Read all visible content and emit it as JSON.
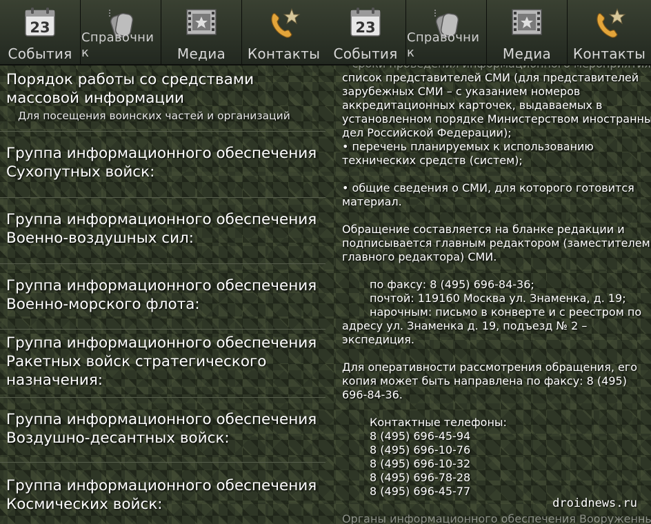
{
  "tabs": [
    {
      "label": "События",
      "icon": "calendar-icon",
      "day": "23"
    },
    {
      "label": "Справочник",
      "icon": "dog-tag-icon"
    },
    {
      "label": "Медиа",
      "icon": "film-icon"
    },
    {
      "label": "Контакты",
      "icon": "phone-star-icon"
    }
  ],
  "left": {
    "rows": [
      {
        "title": "Порядок работы со средствами массовой информации",
        "subtitle": "Для посещения воинских частей и организаций"
      },
      {
        "title": "Группа информационного обеспечения Сухопутных войск:"
      },
      {
        "title": "Группа информационного обеспечения Военно-воздушных сил:"
      },
      {
        "title": "Группа информационного обеспечения Военно-морского флота:"
      },
      {
        "title": "Группа информационного обеспечения Ракетных войск стратегического назначения:"
      },
      {
        "title": "Группа информационного обеспечения Воздушно-десантных войск:"
      },
      {
        "title": "Группа информационного обеспечения Космических войск:"
      }
    ]
  },
  "right": {
    "lines": [
      "• сроки проведения информационного мероприятия;",
      "список представителей СМИ (для представителей",
      "зарубежных СМИ – с указанием номеров",
      "аккредитационных карточек, выдаваемых в",
      "установленном порядке Министерством иностранных",
      "дел Российской Федерации);",
      " • перечень планируемых к использованию",
      "технических средств (систем);",
      "",
      " • общие сведения о СМИ, для которого готовится",
      "материал.",
      "",
      "Обращение составляется на бланке редакции и",
      "подписывается главным редактором (заместителем",
      "главного редактора) СМИ.",
      "",
      "по факсу: 8 (495) 696-84-36;",
      "почтой: 119160 Москва ул. Знаменка, д. 19;",
      "нарочным: письмо в конверте и с реестром по",
      "адресу ул. Знаменка д. 19, подъезд № 2 –",
      "экспедиция.",
      "",
      "Для оперативности рассмотрения обращения, его",
      "копия может быть направлена по факсу: 8 (495)",
      "696-84-36.",
      "",
      "Контактные телефоны:",
      "8 (495) 696-45-94",
      "8 (495) 696-10-76",
      "8 (495) 696-10-32",
      "8 (495) 696-78-28",
      "8 (495) 696-45-77",
      "",
      "Органы информационного обеспечения Вооруженных"
    ]
  },
  "watermark": "droidnews.ru"
}
